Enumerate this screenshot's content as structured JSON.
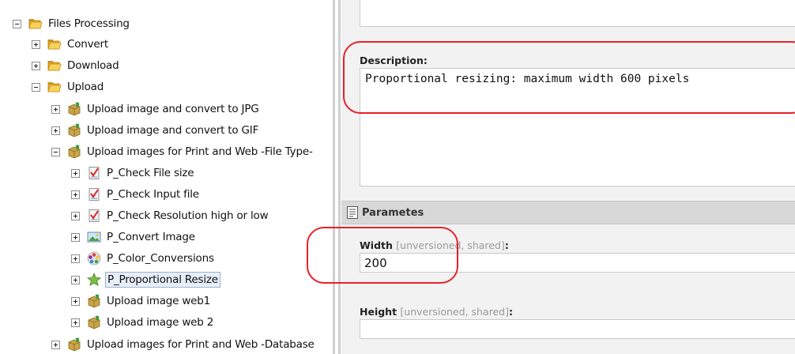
{
  "tree": {
    "root": "Files Processing",
    "convert": "Convert",
    "download": "Download",
    "upload": "Upload",
    "upload_jpg": "Upload image and convert to JPG",
    "upload_gif": "Upload image and convert to GIF",
    "upload_print_web_filetype": "Upload images for Print and Web -File Type-",
    "check_file_size": "P_Check File size",
    "check_input_file": "P_Check Input file",
    "check_resolution": "P_Check Resolution high or low",
    "convert_image": "P_Convert Image",
    "color_conversions": "P_Color_Conversions",
    "proportional_resize": "P_Proportional Resize",
    "upload_web1": "Upload image web1",
    "upload_web2": "Upload image web 2",
    "upload_print_web_database": "Upload images for Print and Web -Database"
  },
  "details": {
    "description_label": "Description:",
    "description_value": "Proportional resizing: maximum width 600 pixels",
    "section_title": "Parametes",
    "width_label": "Width",
    "width_meta": "[unversioned, shared]",
    "width_colon": ":",
    "width_value": "200",
    "height_label": "Height",
    "height_meta": "[unversioned, shared]",
    "height_colon": ":"
  },
  "icons": {
    "toggle_expanded": "minus-toggle-icon",
    "toggle_collapsed": "plus-toggle-icon",
    "folder": "folder-icon",
    "workflow": "workflow-icon",
    "check": "checklist-icon",
    "image": "image-icon",
    "color": "color-wheel-icon",
    "resize": "star-icon",
    "section": "parameters-icon"
  },
  "colors": {
    "highlight": "#e8202a",
    "selection": "#e8eef7",
    "folder": "#f3c33d"
  }
}
